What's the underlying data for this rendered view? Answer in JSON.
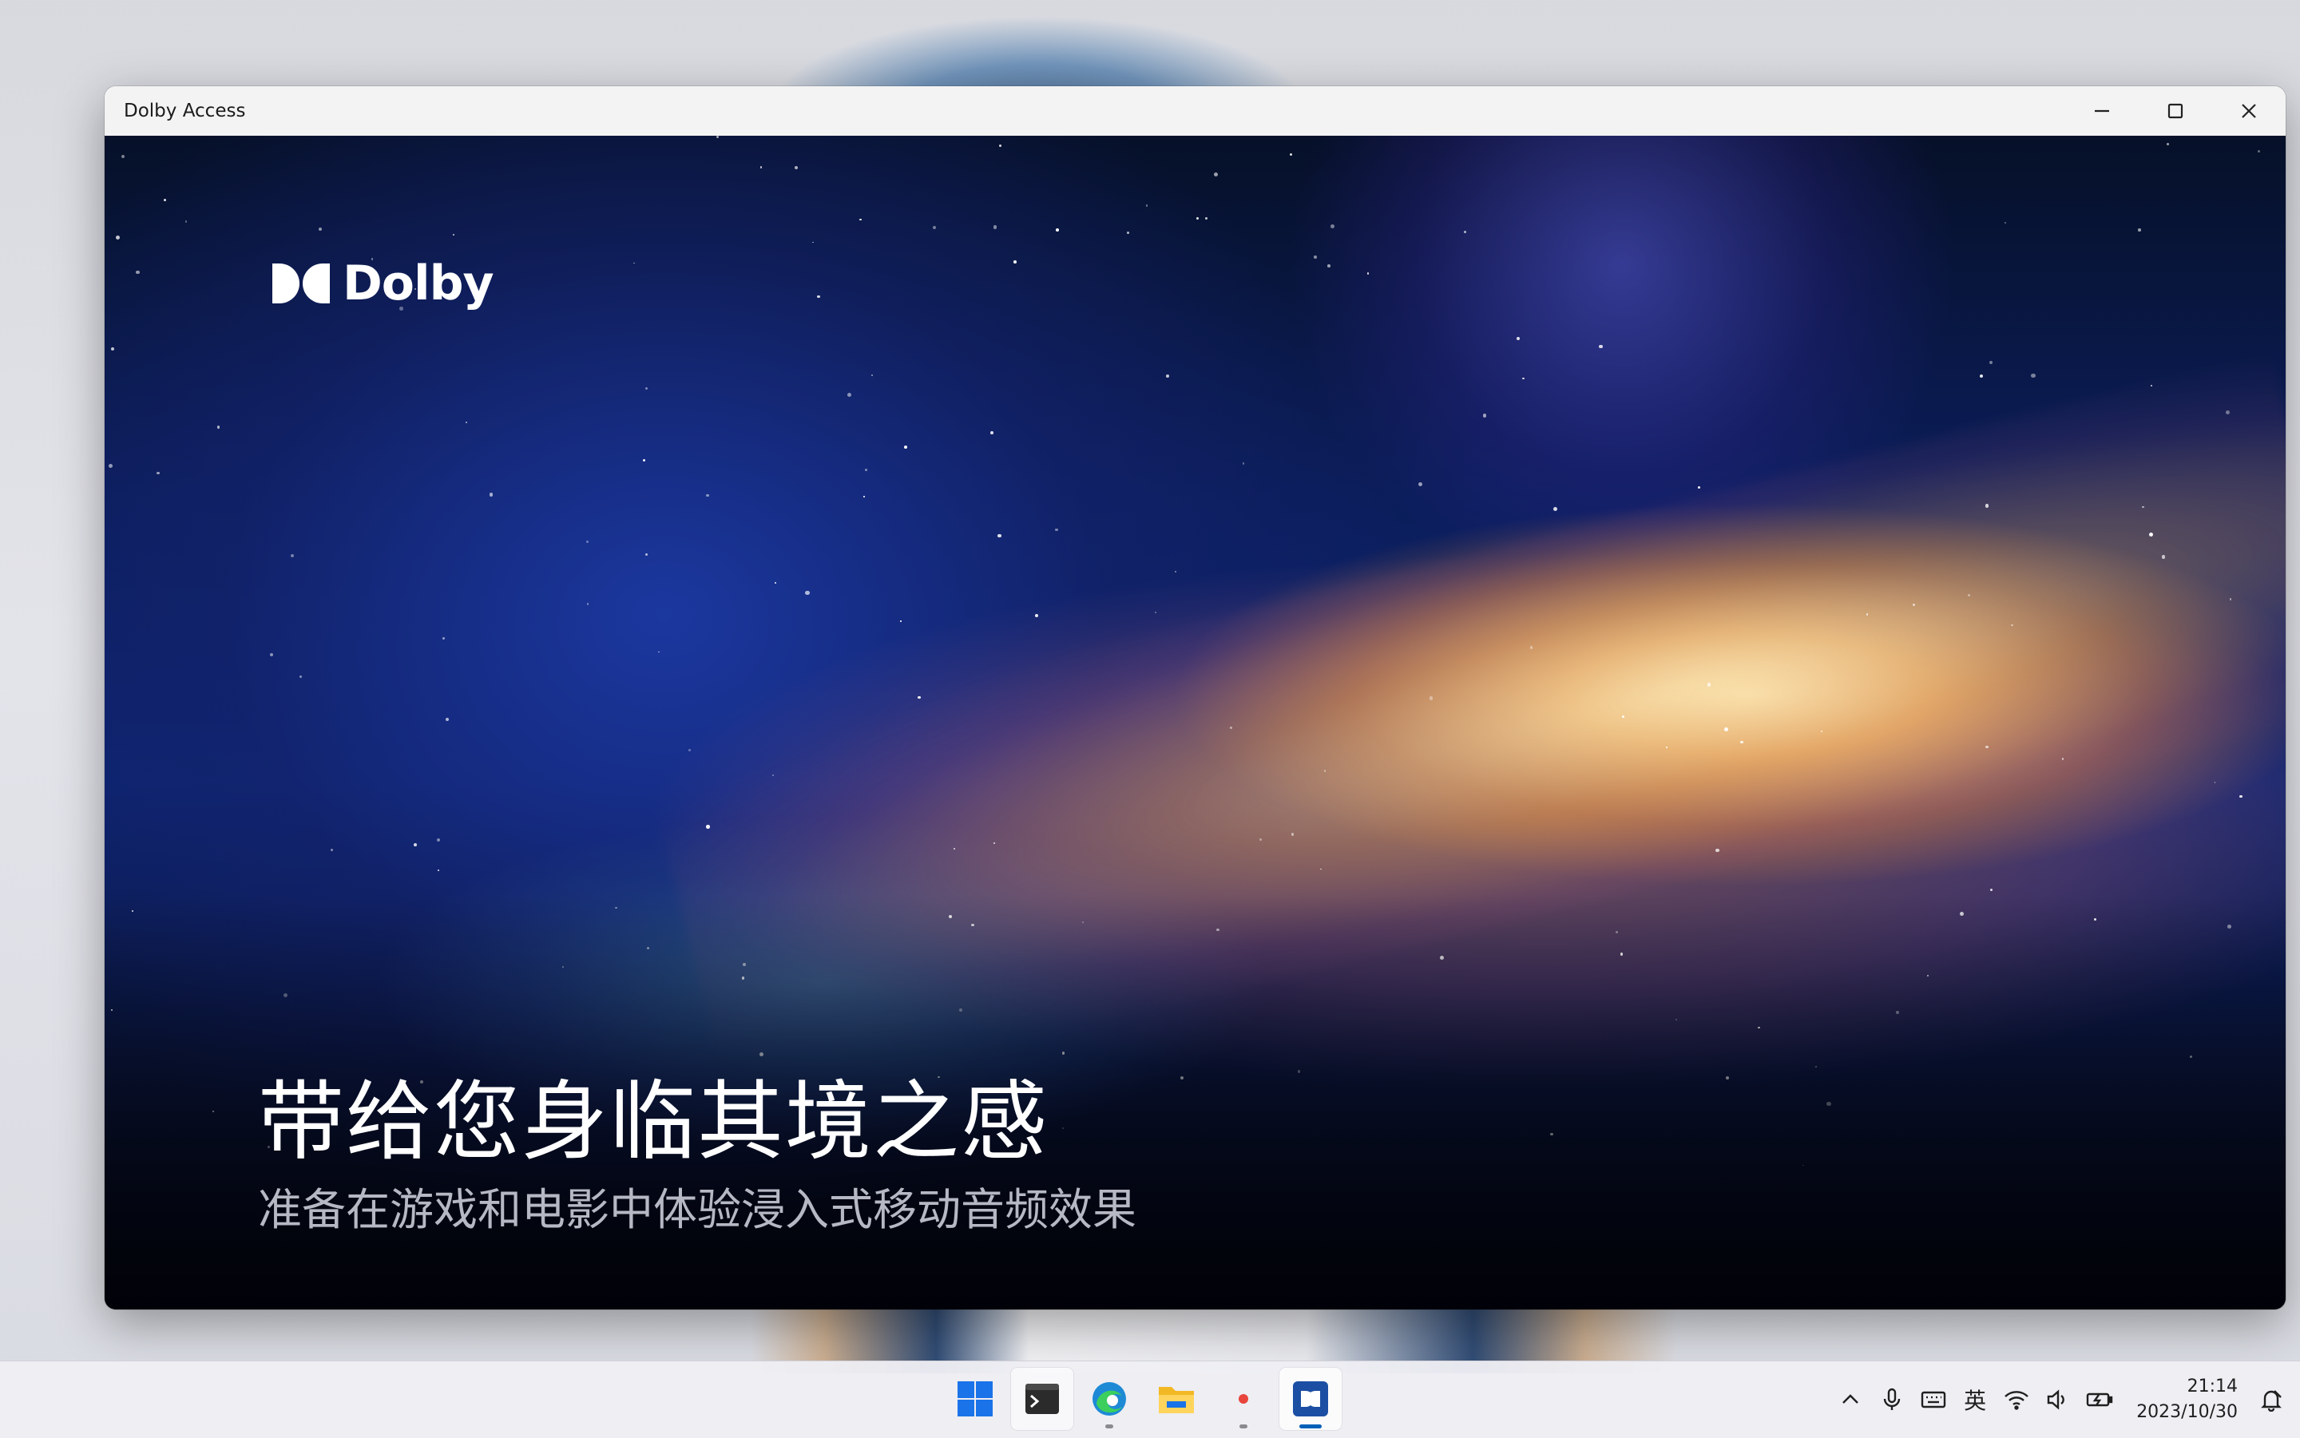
{
  "window": {
    "title": "Dolby Access",
    "controls": [
      "minimize",
      "maximize",
      "close"
    ]
  },
  "hero": {
    "logo_text": "Dolby",
    "headline": "带给您身临其境之感",
    "subline": "准备在游戏和电影中体验浸入式移动音频效果"
  },
  "taskbar": {
    "apps": [
      {
        "name": "start-icon",
        "active": false,
        "running": false
      },
      {
        "name": "terminal-icon",
        "active": false,
        "running": false
      },
      {
        "name": "edge-icon",
        "active": false,
        "running": true
      },
      {
        "name": "file-explorer-icon",
        "active": false,
        "running": false
      },
      {
        "name": "recorder-icon",
        "active": false,
        "running": true
      },
      {
        "name": "dolby-access-icon",
        "active": true,
        "running": true
      }
    ],
    "tray": {
      "ime_label": "英",
      "time": "21:14",
      "date": "2023/10/30"
    }
  },
  "colors": {
    "accent": "#005fb8",
    "titlebar": "#f3f3f3"
  }
}
